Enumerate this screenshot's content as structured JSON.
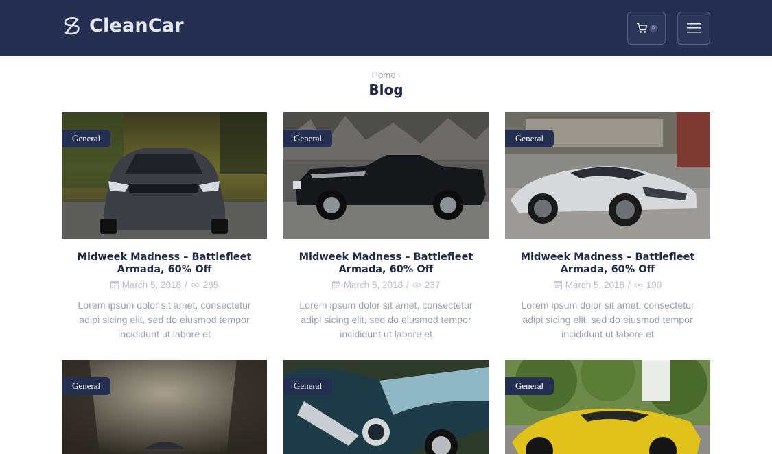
{
  "brand": {
    "name": "CleanCar"
  },
  "header": {
    "cart_count": "0"
  },
  "breadcrumb": {
    "home": "Home"
  },
  "page": {
    "title": "Blog"
  },
  "posts": [
    {
      "category": "General",
      "title": "Midweek Madness – Battlefleet Armada, 60% Off",
      "date": "March 5, 2018",
      "views": "285",
      "excerpt": "Lorem ipsum dolor sit amet, consectetur adipi sicing elit, sed do eiusmod tempor incididunt ut labore et"
    },
    {
      "category": "General",
      "title": "Midweek Madness – Battlefleet Armada, 60% Off",
      "date": "March 5, 2018",
      "views": "237",
      "excerpt": "Lorem ipsum dolor sit amet, consectetur adipi sicing elit, sed do eiusmod tempor incididunt ut labore et"
    },
    {
      "category": "General",
      "title": "Midweek Madness – Battlefleet Armada, 60% Off",
      "date": "March 5, 2018",
      "views": "190",
      "excerpt": "Lorem ipsum dolor sit amet, consectetur adipi sicing elit, sed do eiusmod tempor incididunt ut labore et"
    },
    {
      "category": "General"
    },
    {
      "category": "General"
    },
    {
      "category": "General"
    }
  ],
  "colors": {
    "header_bg": "#252f52",
    "title": "#1f2a48",
    "muted": "#b8bbc6",
    "badge_bg": "#252f52"
  },
  "icons": {
    "logo": "s-swirl-logo-icon",
    "cart": "cart-icon",
    "menu": "hamburger-menu-icon",
    "date": "calendar-icon",
    "views": "eye-icon"
  }
}
